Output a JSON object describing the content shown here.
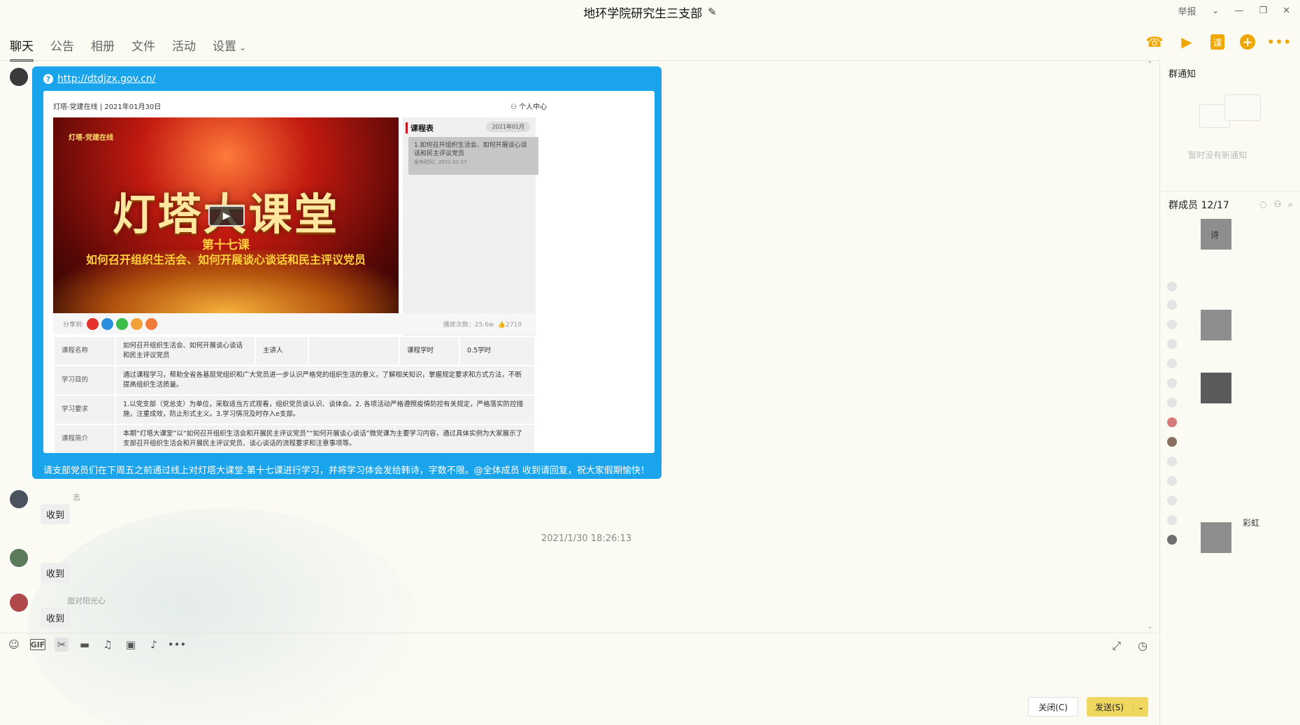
{
  "window": {
    "title": "地环学院研究生三支部",
    "report": "举报"
  },
  "tabs": [
    {
      "label": "聊天"
    },
    {
      "label": "公告"
    },
    {
      "label": "相册"
    },
    {
      "label": "文件"
    },
    {
      "label": "活动"
    },
    {
      "label": "设置"
    }
  ],
  "toolbar_icons": [
    "phone-icon",
    "video-call-icon",
    "course-icon",
    "add-icon",
    "more-icon"
  ],
  "toolbar_course_label": "课",
  "shared_message": {
    "url": "http://dtdjzx.gov.cn/",
    "preview": {
      "site_header": "灯塔-党建在线 | 2021年01月30日",
      "user_center": "个人中心",
      "video_logo": "灯塔-党建在线",
      "video_title": "灯塔大课堂",
      "video_lesson": "第十七课",
      "video_subtitle": "如何召开组织生活会、如何开展谈心谈话和民主评议党员",
      "schedule_title": "课程表",
      "schedule_month": "2021年01月",
      "schedule_item": "1.如何召开组织生活会、如何开展谈心谈话和民主评议党员",
      "schedule_item_date": "发布时间：2021-01-27",
      "share_label": "分享到:",
      "play_count": "播放次数：25.6w",
      "like_count": "2719",
      "rows": [
        {
          "k1": "课程名称",
          "v1": "如何召开组织生活会、如何开展谈心谈话和民主评议党员",
          "k2": "主讲人",
          "v2": "",
          "k3": "课程学时",
          "v3": "0.5学时"
        },
        {
          "k": "学习目的",
          "v": "通过课程学习，帮助全省各基层党组织和广大党员进一步认识严格党的组织生活的意义，了解相关知识，掌握规定要求和方式方法，不断提高组织生活质量。"
        },
        {
          "k": "学习要求",
          "v": "1.以党支部（党总支）为单位，采取适当方式观看，组织党员谈认识、谈体会。2. 各项活动严格遵照疫情防控有关规定，严格落实防控措施，注重成效，防止形式主义。3.学习情况及时存入e支部。"
        },
        {
          "k": "课程简介",
          "v": "本期“灯塔大课堂”以“如何召开组织生活会和开展民主评议党员”“如何开展谈心谈话”微党课为主要学习内容，通过具体实例为大家展示了支部召开组织生活会和开展民主评议党员、谈心谈话的流程要求和注意事项等。"
        }
      ]
    },
    "text": "请支部党员们在下周五之前通过线上对灯塔大课堂-第十七课进行学习，并将学习体会发给韩诗，字数不限。@全体成员 收到请回复，祝大家假期愉快！"
  },
  "replies": [
    {
      "name": "志",
      "text": "收到"
    },
    {
      "name": "",
      "text": "收到"
    },
    {
      "name": "面对阳光心",
      "text": "收到"
    }
  ],
  "timestamp": "2021/1/30 18:26:13",
  "input_toolbar": [
    "emoji-icon",
    "gif-icon",
    "scissors-icon",
    "folder-icon",
    "music-icon",
    "image-icon",
    "bell-icon",
    "more-icon"
  ],
  "gif_label": "GIF",
  "buttons": {
    "close": "关闭(C)",
    "send": "发送(S)"
  },
  "sidebar": {
    "notice_title": "群通知",
    "notice_empty": "暂时没有新通知",
    "members_title": "群成员 12/17",
    "member_names": [
      "诗",
      "彩虹"
    ]
  },
  "colors": {
    "accent": "#f0a800",
    "bubble": "#1aa4ec",
    "send_button": "#f0d860"
  }
}
